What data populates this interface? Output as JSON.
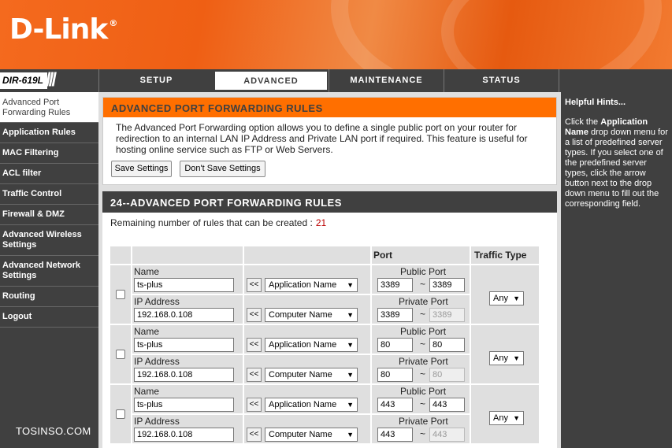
{
  "brand": {
    "logo": "D-Link",
    "reg": "®",
    "model": "DIR-619L"
  },
  "nav": {
    "tabs": [
      "SETUP",
      "ADVANCED",
      "MAINTENANCE",
      "STATUS"
    ],
    "active": "ADVANCED"
  },
  "sidebar": {
    "items": [
      "Advanced Port Forwarding Rules",
      "Application Rules",
      "MAC Filtering",
      "ACL filter",
      "Traffic Control",
      "Firewall & DMZ",
      "Advanced Wireless Settings",
      "Advanced Network Settings",
      "Routing",
      "Logout"
    ]
  },
  "watermark": "TOSINSO.COM",
  "main": {
    "section1": {
      "title": "ADVANCED PORT FORWARDING RULES",
      "description": "The Advanced Port Forwarding option allows you to define a single public port on your router for redirection to an internal LAN IP Address and Private LAN port if required. This feature is useful for hosting online service such as FTP or Web Servers.",
      "save_label": "Save Settings",
      "dont_save_label": "Don't Save Settings"
    },
    "section2": {
      "title": "24--ADVANCED PORT FORWARDING RULES",
      "remaining_label": "Remaining number of rules that can be created :",
      "remaining_value": "21",
      "headers": {
        "port": "Port",
        "traffic": "Traffic Type"
      },
      "labels": {
        "name": "Name",
        "ip": "IP Address",
        "public_port": "Public Port",
        "private_port": "Private Port",
        "copy": "<<",
        "tilde": "~",
        "app_select": "Application Name",
        "comp_select": "Computer Name"
      },
      "rules": [
        {
          "name": "ts-plus",
          "ip": "192.168.0.108",
          "public_start": "3389",
          "public_end": "3389",
          "private_start": "3389",
          "private_end": "3389",
          "traffic": "Any"
        },
        {
          "name": "ts-plus",
          "ip": "192.168.0.108",
          "public_start": "80",
          "public_end": "80",
          "private_start": "80",
          "private_end": "80",
          "traffic": "Any"
        },
        {
          "name": "ts-plus",
          "ip": "192.168.0.108",
          "public_start": "443",
          "public_end": "443",
          "private_start": "443",
          "private_end": "443",
          "traffic": "Any"
        }
      ]
    }
  },
  "hints": {
    "title": "Helpful Hints...",
    "pre": "Click the ",
    "strong": "Application Name",
    "post": " drop down menu for a list of predefined server types. If you select one of the predefined server types, click the arrow button next to the drop down menu to fill out the corresponding field."
  }
}
